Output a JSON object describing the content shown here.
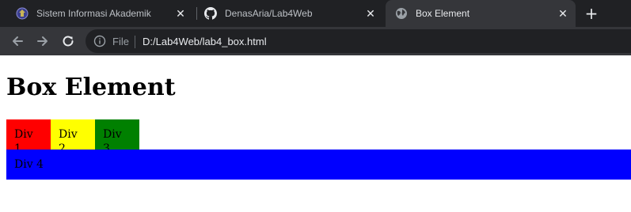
{
  "browser": {
    "tabs": [
      {
        "title": "Sistem Informasi Akademik",
        "icon": "university-logo-icon",
        "active": false
      },
      {
        "title": "DenasAria/Lab4Web",
        "icon": "github-icon",
        "active": false
      },
      {
        "title": "Box Element",
        "icon": "globe-icon",
        "active": true
      }
    ],
    "close_glyph": "✕",
    "new_tab_glyph": "+",
    "address": {
      "scheme_label": "File",
      "url": "D:/Lab4Web/lab4_box.html"
    }
  },
  "page": {
    "heading": "Box Element",
    "boxes": [
      {
        "label": "Div 1",
        "color": "#ff0000"
      },
      {
        "label": "Div 2",
        "color": "#ffff00"
      },
      {
        "label": "Div 3",
        "color": "#008000"
      },
      {
        "label": "Div 4",
        "color": "#0000ff"
      }
    ]
  }
}
